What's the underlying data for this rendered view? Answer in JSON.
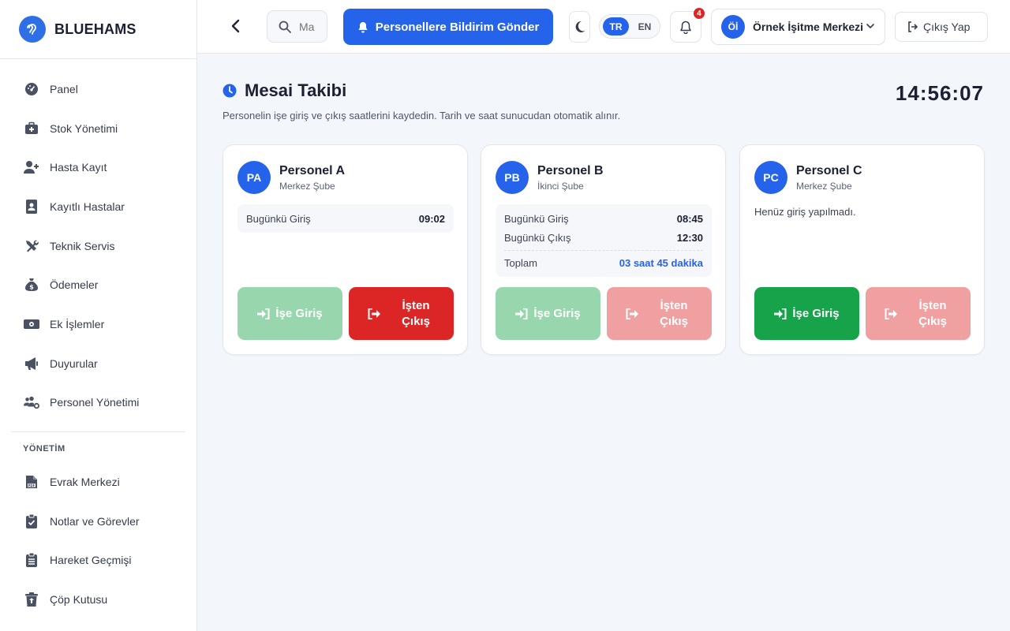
{
  "brand": {
    "name": "BLUEHAMS"
  },
  "sidebar": {
    "items": [
      {
        "label": "Panel",
        "icon": "gauge-icon"
      },
      {
        "label": "Stok Yönetimi",
        "icon": "medkit-icon"
      },
      {
        "label": "Hasta Kayıt",
        "icon": "user-plus-icon"
      },
      {
        "label": "Kayıtlı Hastalar",
        "icon": "address-book-icon"
      },
      {
        "label": "Teknik Servis",
        "icon": "tools-icon"
      },
      {
        "label": "Ödemeler",
        "icon": "money-bag-icon"
      },
      {
        "label": "Ek İşlemler",
        "icon": "money-bill-icon"
      },
      {
        "label": "Duyurular",
        "icon": "bullhorn-icon"
      },
      {
        "label": "Personel Yönetimi",
        "icon": "users-gear-icon"
      }
    ],
    "section_title": "YÖNETİM",
    "admin_items": [
      {
        "label": "Evrak Merkezi",
        "icon": "file-pdf-icon"
      },
      {
        "label": "Notlar ve Görevler",
        "icon": "clipboard-check-icon"
      },
      {
        "label": "Hareket Geçmişi",
        "icon": "clipboard-list-icon"
      },
      {
        "label": "Çöp Kutusu",
        "icon": "trash-restore-icon"
      }
    ]
  },
  "topbar": {
    "search_placeholder": "Ma",
    "notify_label": "Personellere Bildirim Gönder",
    "lang_active": "TR",
    "lang_inactive": "EN",
    "notification_count": "4",
    "user_initials": "Öİ",
    "user_name": "Örnek İşitme Merkezi",
    "logout_label": "Çıkış Yap"
  },
  "page": {
    "title": "Mesai Takibi",
    "subtitle": "Personelin işe giriş ve çıkış saatlerini kaydedin. Tarih ve saat sunucudan otomatik alınır.",
    "clock": "14:56:07"
  },
  "labels": {
    "checkin_label": "Bugünkü Giriş",
    "checkout_label": "Bugünkü Çıkış",
    "total_label": "Toplam",
    "btn_in_label": "İşe Giriş",
    "btn_out_line1": "İşten",
    "btn_out_line2": "Çıkış"
  },
  "staff": [
    {
      "initials": "PA",
      "name": "Personel A",
      "branch": "Merkez Şube",
      "checkin": "09:02"
    },
    {
      "initials": "PB",
      "name": "Personel B",
      "branch": "İkinci Şube",
      "checkin": "08:45",
      "checkout": "12:30",
      "total": "03 saat 45 dakika"
    },
    {
      "initials": "PC",
      "name": "Personel C",
      "branch": "Merkez Şube",
      "note": "Henüz giriş yapılmadı."
    }
  ],
  "colors": {
    "primary": "#2563eb",
    "success": "#16a34a",
    "danger": "#dc2626"
  }
}
